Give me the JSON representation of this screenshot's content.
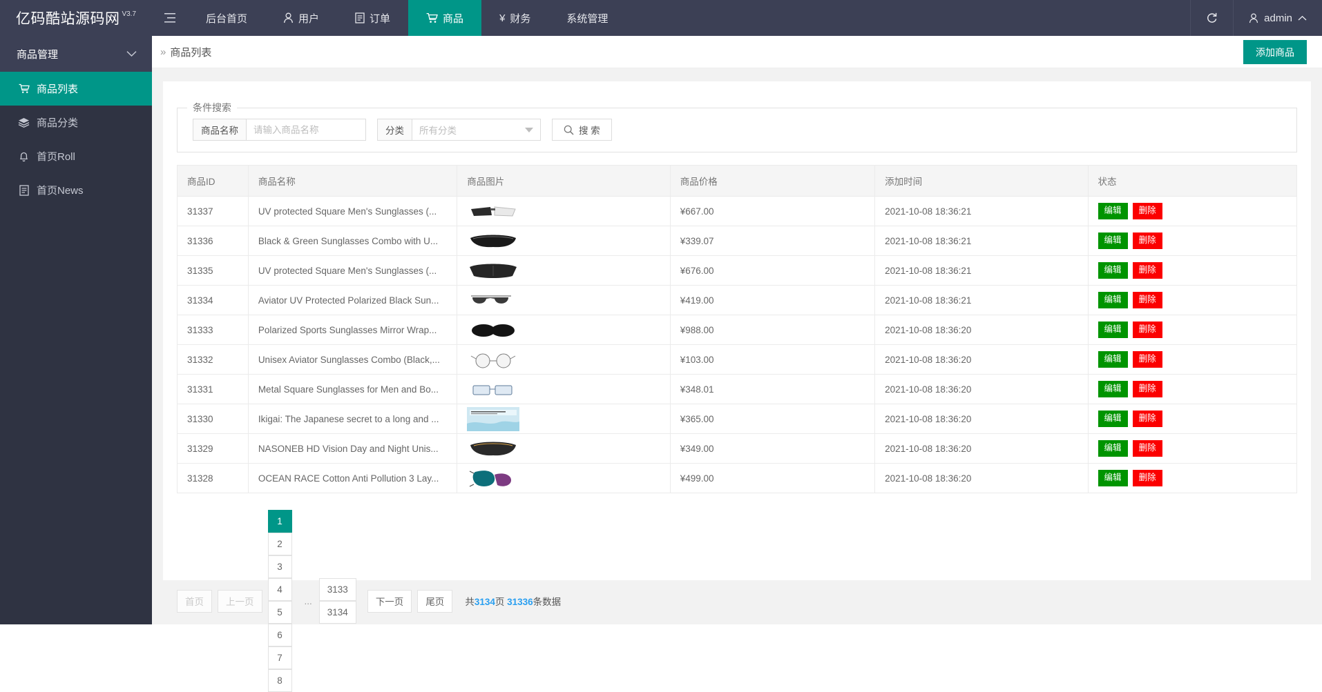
{
  "topbar": {
    "brand_name": "亿码酷站源码网",
    "brand_version": "V3.7",
    "menu_toggle_icon": "hamburger-icon",
    "nav": [
      {
        "label": "后台首页",
        "icon": "",
        "active": false
      },
      {
        "label": "用户",
        "icon": "user-icon",
        "active": false
      },
      {
        "label": "订单",
        "icon": "file-icon",
        "active": false
      },
      {
        "label": "商品",
        "icon": "cart-icon",
        "active": true
      },
      {
        "label": "财务",
        "icon": "yen-icon",
        "active": false
      },
      {
        "label": "系统管理",
        "icon": "",
        "active": false
      }
    ],
    "refresh_icon": "refresh-icon",
    "user_label": "admin",
    "user_icon": "user-icon",
    "user_caret_icon": "chevron-up-icon"
  },
  "sidebar": {
    "header": "商品管理",
    "header_icon": "chevron-down-icon",
    "items": [
      {
        "label": "商品列表",
        "icon": "cart-icon",
        "active": true
      },
      {
        "label": "商品分类",
        "icon": "layers-icon",
        "active": false
      },
      {
        "label": "首页Roll",
        "icon": "bell-icon",
        "active": false
      },
      {
        "label": "首页News",
        "icon": "news-icon",
        "active": false
      }
    ]
  },
  "breadcrumb": {
    "separator": "»",
    "title": "商品列表"
  },
  "add_button": {
    "label": "添加商品",
    "color": "#009688"
  },
  "search": {
    "legend": "条件搜索",
    "name_label": "商品名称",
    "name_value": "",
    "name_placeholder": "请输入商品名称",
    "category_label": "分类",
    "category_value": "所有分类",
    "search_button": "搜 索",
    "search_icon": "search-icon"
  },
  "table": {
    "columns": [
      "商品ID",
      "商品名称",
      "商品图片",
      "商品价格",
      "添加时间",
      "状态"
    ],
    "rows": [
      {
        "id": "31337",
        "name": "UV protected Square Men's Sunglasses (...",
        "image": "sunglasses-white-black",
        "price": "¥667.00",
        "time": "2021-10-08 18:36:21"
      },
      {
        "id": "31336",
        "name": "Black & Green Sunglasses Combo with U...",
        "image": "sunglasses-black-sport",
        "price": "¥339.07",
        "time": "2021-10-08 18:36:21"
      },
      {
        "id": "31335",
        "name": "UV protected Square Men's Sunglasses (...",
        "image": "sunglasses-dark-wrap",
        "price": "¥676.00",
        "time": "2021-10-08 18:36:21"
      },
      {
        "id": "31334",
        "name": "Aviator UV Protected Polarized Black Sun...",
        "image": "sunglasses-aviator",
        "price": "¥419.00",
        "time": "2021-10-08 18:36:21"
      },
      {
        "id": "31333",
        "name": "Polarized Sports Sunglasses Mirror Wrap...",
        "image": "sunglasses-sport-black",
        "price": "¥988.00",
        "time": "2021-10-08 18:36:20"
      },
      {
        "id": "31332",
        "name": "Unisex Aviator Sunglasses Combo (Black,...",
        "image": "sunglasses-thin-frame",
        "price": "¥103.00",
        "time": "2021-10-08 18:36:20"
      },
      {
        "id": "31331",
        "name": "Metal Square Sunglasses for Men and Bo...",
        "image": "sunglasses-metal-square",
        "price": "¥348.01",
        "time": "2021-10-08 18:36:20"
      },
      {
        "id": "31330",
        "name": "Ikigai: The Japanese secret to a long and ...",
        "image": "book-cover-ikigai",
        "price": "¥365.00",
        "time": "2021-10-08 18:36:20"
      },
      {
        "id": "31329",
        "name": "NASONEB HD Vision Day and Night Unis...",
        "image": "sunglasses-hd-vision",
        "price": "¥349.00",
        "time": "2021-10-08 18:36:20"
      },
      {
        "id": "31328",
        "name": "OCEAN RACE Cotton Anti Pollution 3 Lay...",
        "image": "face-mask-teal-purple",
        "price": "¥499.00",
        "time": "2021-10-08 18:36:20"
      }
    ],
    "edit_label": "编辑",
    "delete_label": "删除",
    "edit_color": "#009400",
    "delete_color": "#fb0000"
  },
  "pagination": {
    "first": "首页",
    "prev": "上一页",
    "pages": [
      "1",
      "2",
      "3",
      "4",
      "5",
      "6",
      "7",
      "8"
    ],
    "current": "1",
    "dots": "...",
    "tail_pages": [
      "3133",
      "3134"
    ],
    "next": "下一页",
    "last": "尾页",
    "summary_prefix": "共",
    "total_pages": "3134",
    "summary_mid": "页 ",
    "total_records": "31336",
    "summary_suffix": "条数据"
  }
}
